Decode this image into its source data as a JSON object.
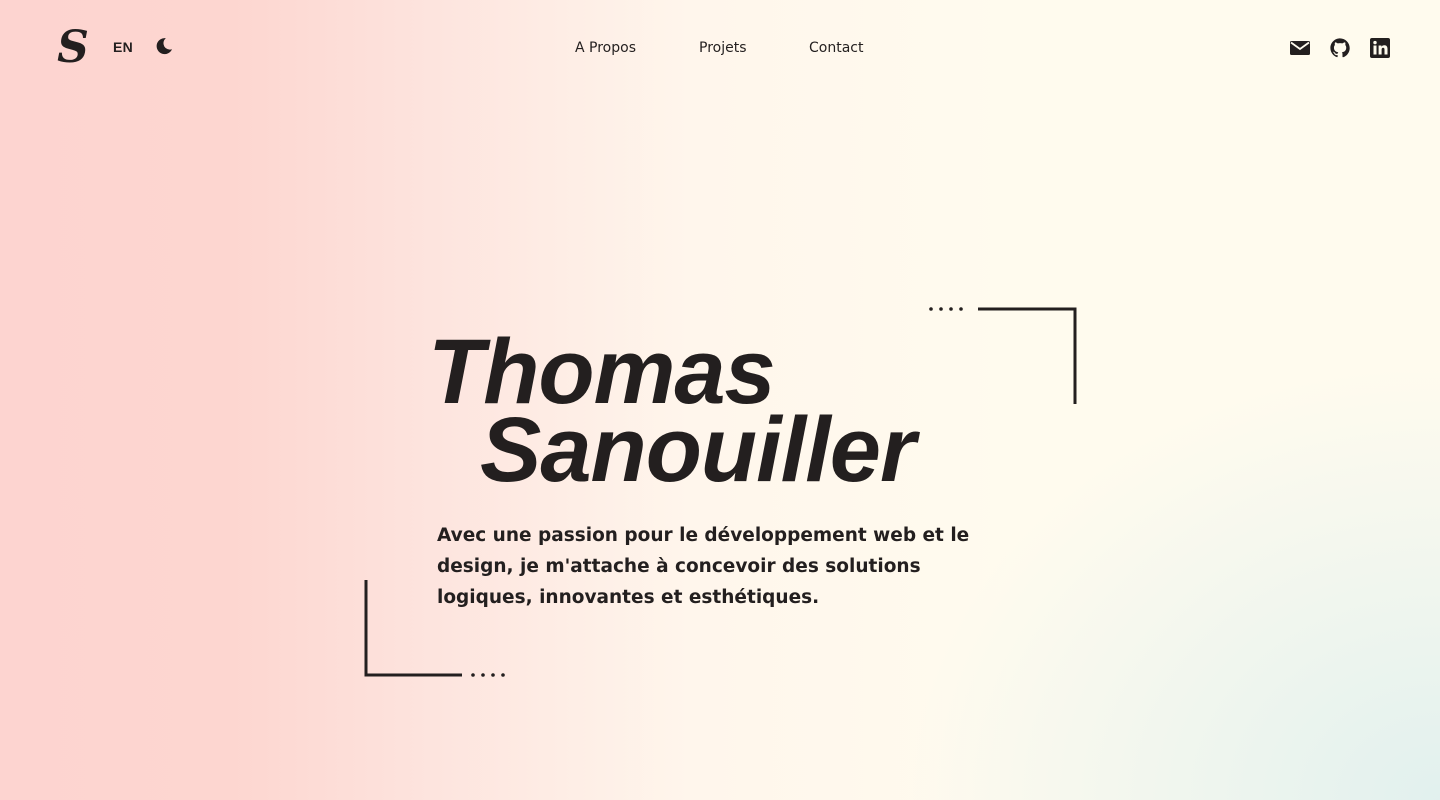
{
  "header": {
    "logo_letter": "S",
    "language": "EN",
    "theme_icon": "moon-icon",
    "nav": [
      {
        "label": "A Propos"
      },
      {
        "label": "Projets"
      },
      {
        "label": "Contact"
      }
    ],
    "social_icons": [
      "mail-icon",
      "github-icon",
      "linkedin-icon"
    ]
  },
  "hero": {
    "first_name": "Thomas",
    "last_name": "Sanouiller",
    "tagline_lines": [
      "Avec une passion pour le développement web et le",
      "design, je m'attache à concevoir des solutions",
      "logiques, innovantes et esthétiques."
    ]
  },
  "colors": {
    "text": "#231f1f",
    "bg_left": "#fdd4d0",
    "bg_center": "#fffbee",
    "bg_corner": "#e0f0ee"
  }
}
